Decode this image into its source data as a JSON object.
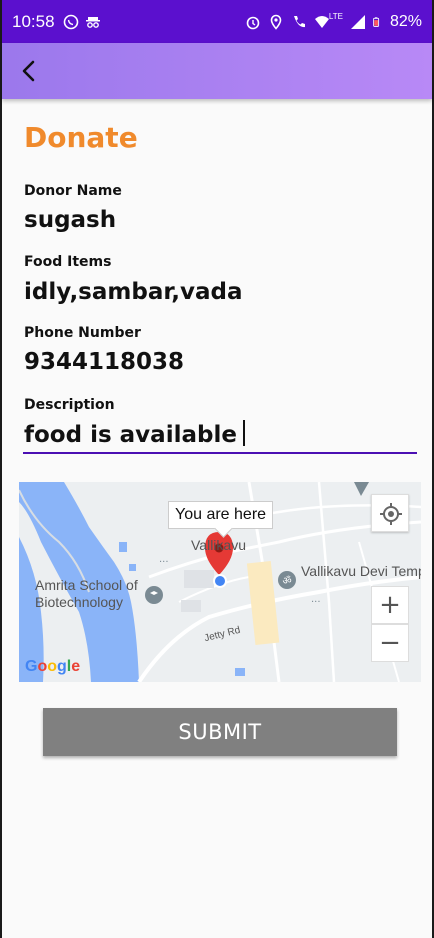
{
  "status_bar": {
    "time": "10:58",
    "battery": "82%",
    "network": "LTE",
    "icons": [
      "whatsapp-icon",
      "incognito-icon",
      "alarm-icon",
      "location-icon",
      "wifi-call-icon",
      "wifi-icon",
      "signal-icon",
      "battery-icon"
    ]
  },
  "app_bar": {
    "back_icon": "back-arrow-icon"
  },
  "form": {
    "title": "Donate",
    "donor_name_label": "Donor Name",
    "donor_name_value": "sugash",
    "food_items_label": "Food Items",
    "food_items_value": "idly,sambar,vada",
    "phone_label": "Phone Number",
    "phone_value": "9344118038",
    "description_label": "Description",
    "description_value": "food is available"
  },
  "map": {
    "tooltip": "You are here",
    "place_vallikavu": "Vallikavu",
    "place_amrita": "Amrita School of\nBiotechnology",
    "place_temple": "Vallikavu Devi Temp",
    "road_label": "Jetty Rd",
    "zoom_in": "+",
    "zoom_out": "−",
    "logo": "Google"
  },
  "actions": {
    "submit_label": "SUBMIT"
  },
  "colors": {
    "status_bar": "#5b10ce",
    "app_bar": "#b889f6",
    "title": "#f08a2c",
    "input_line": "#4b0fb3",
    "submit_bg": "#808080"
  }
}
